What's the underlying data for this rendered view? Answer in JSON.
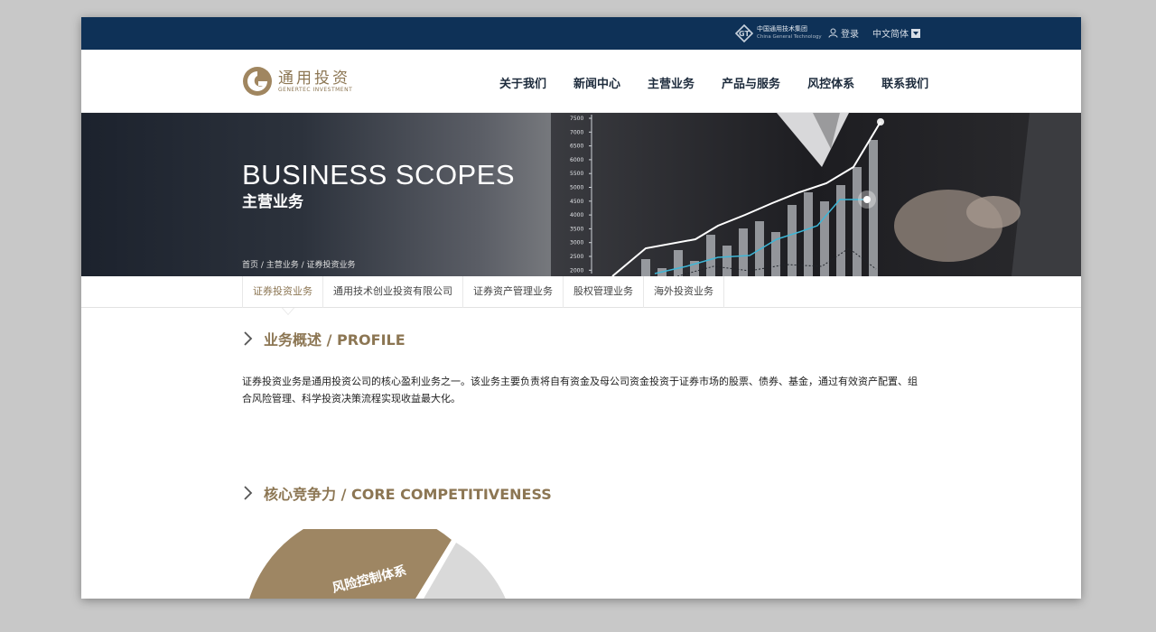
{
  "topbar": {
    "group_logo_cn": "中国通用技术集团",
    "group_logo_en": "China General Technology",
    "login": "登录",
    "language": "中文简体"
  },
  "header": {
    "logo_cn": "通用投资",
    "logo_en": "GENERTEC INVESTMENT",
    "nav": [
      {
        "label": "关于我们"
      },
      {
        "label": "新闻中心"
      },
      {
        "label": "主营业务"
      },
      {
        "label": "产品与服务"
      },
      {
        "label": "风控体系"
      },
      {
        "label": "联系我们"
      }
    ]
  },
  "banner": {
    "title_en": "BUSINESS SCOPES",
    "title_cn": "主营业务",
    "breadcrumb": "首页 / 主营业务 / 证券投资业务",
    "chart_ticks": [
      "7500",
      "7000",
      "6500",
      "6000",
      "5500",
      "5000",
      "4500",
      "4000",
      "3500",
      "3000",
      "2500",
      "2000"
    ]
  },
  "subnav": [
    {
      "label": "证券投资业务",
      "active": true
    },
    {
      "label": "通用技术创业投资有限公司"
    },
    {
      "label": "证券资产管理业务"
    },
    {
      "label": "股权管理业务"
    },
    {
      "label": "海外投资业务"
    }
  ],
  "profile": {
    "title": "业务概述 / PROFILE",
    "text": "证券投资业务是通用投资公司的核心盈利业务之一。该业务主要负责将自有资金及母公司资金投资于证券市场的股票、债券、基金，通过有效资产配置、组合风险管理、科学投资决策流程实现收益最大化。"
  },
  "core": {
    "title": "核心竞争力 / CORE COMPETITIVENESS",
    "pie_label": "风险控制体系"
  },
  "colors": {
    "accent": "#8c7653",
    "topbar": "#0e3157"
  }
}
